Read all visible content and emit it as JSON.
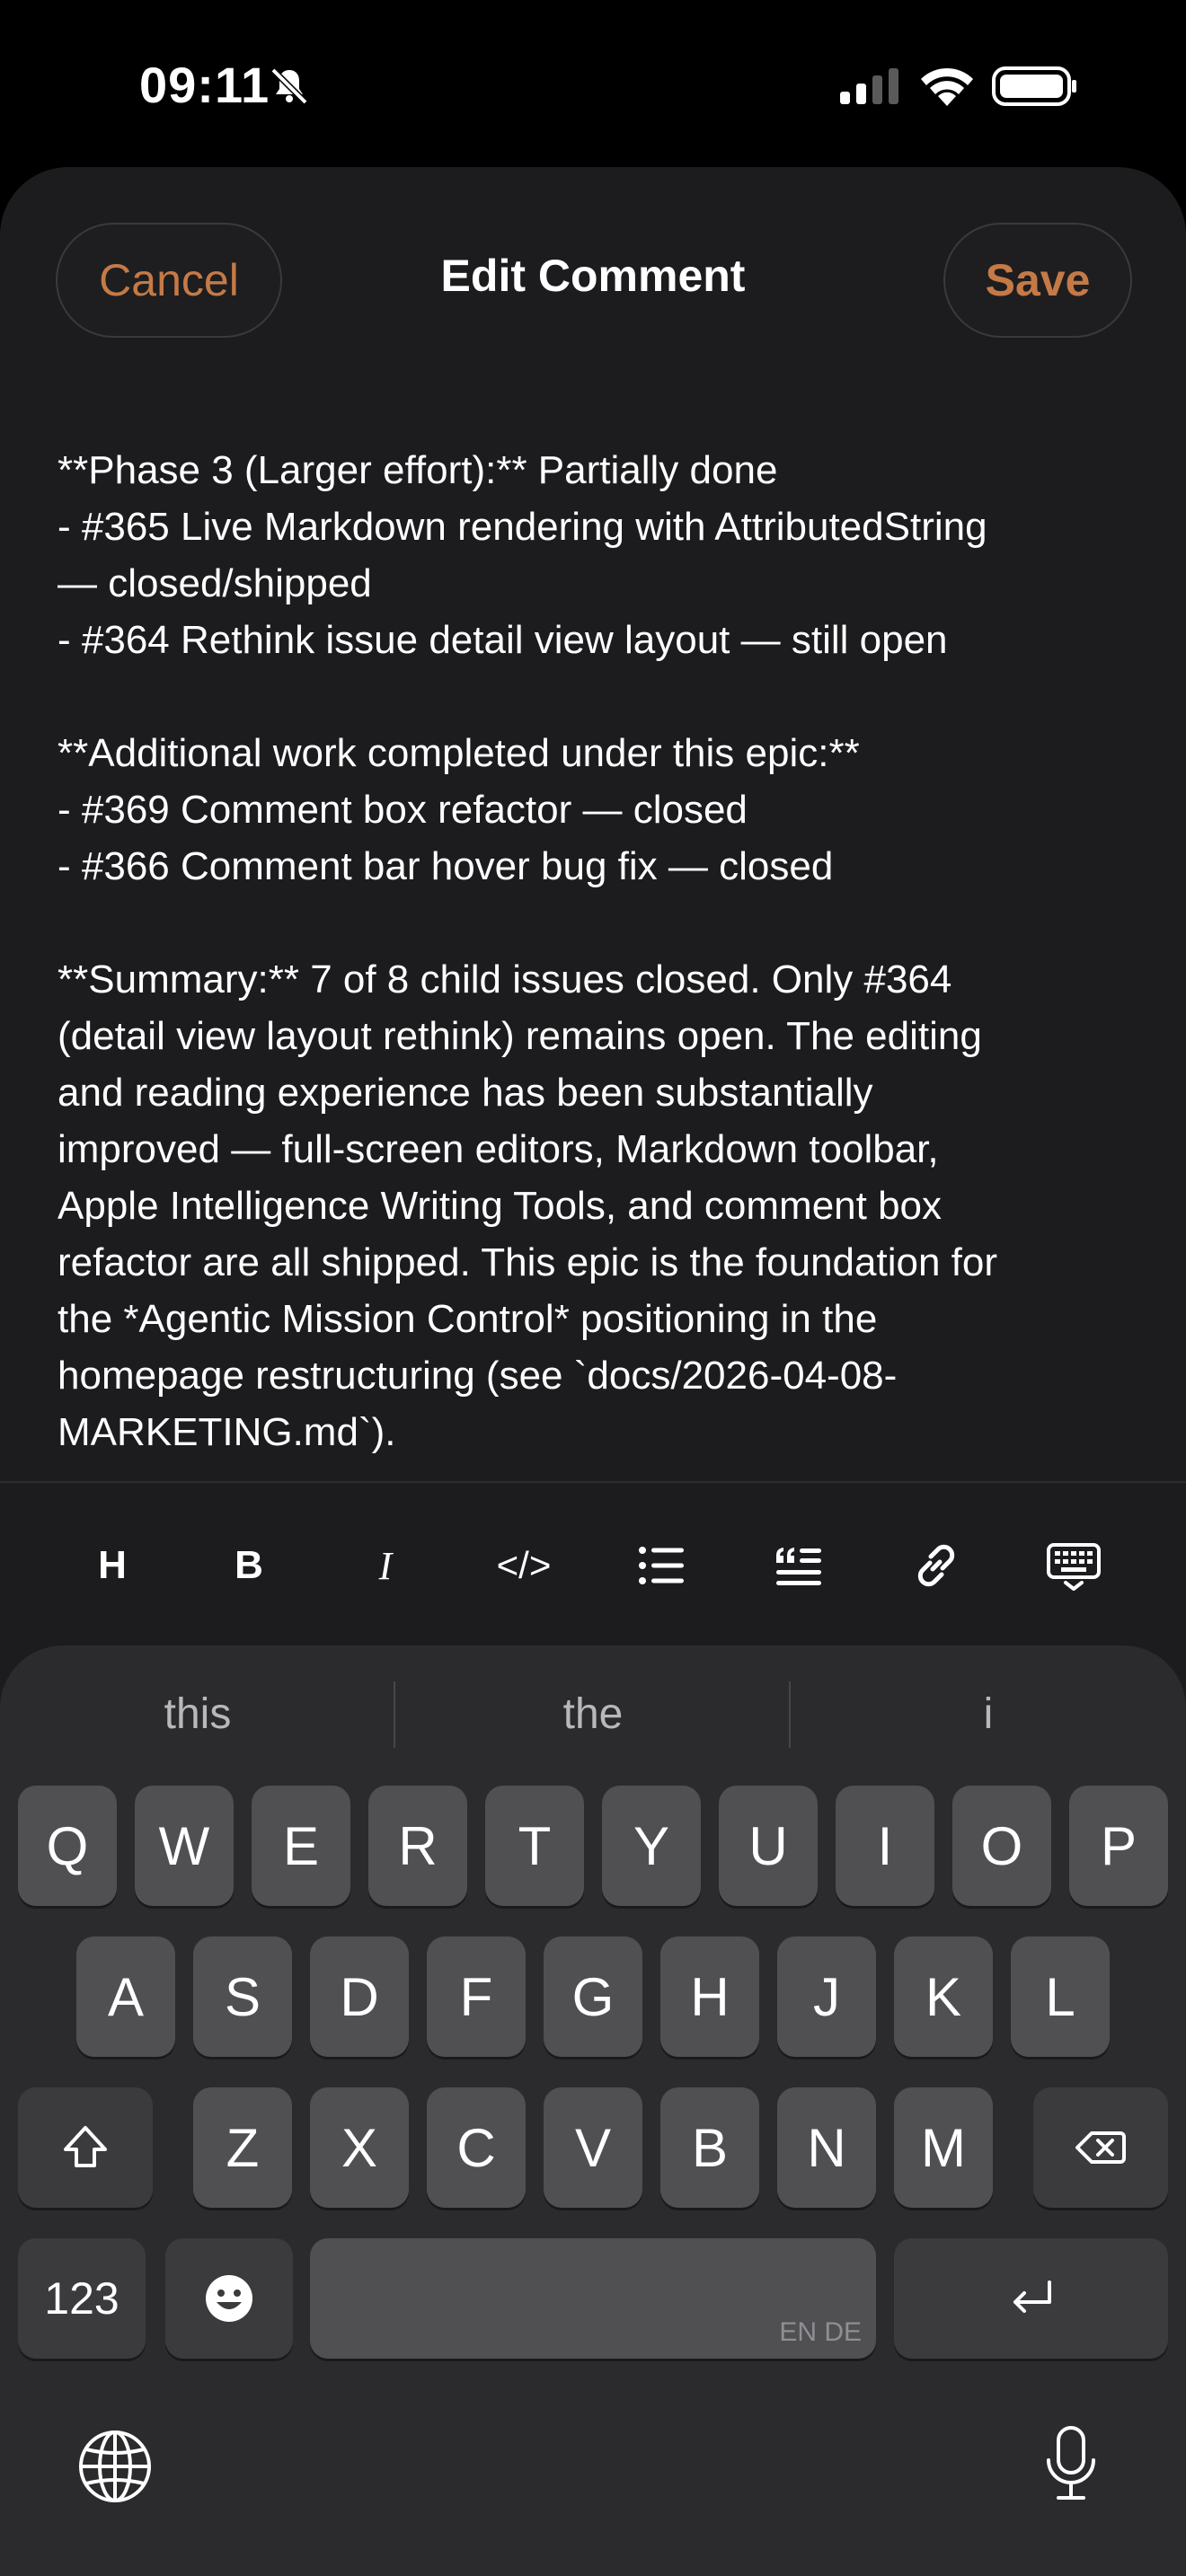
{
  "status_bar": {
    "time": "09:11"
  },
  "sheet": {
    "title": "Edit Comment",
    "cancel_label": "Cancel",
    "save_label": "Save",
    "accent_color": "#c57a46"
  },
  "editor": {
    "text": "**Phase 3 (Larger effort):** Partially done\n- #365 Live Markdown rendering with AttributedString\n— closed/shipped\n- #364 Rethink issue detail view layout — still open\n\n**Additional work completed under this epic:**\n- #369 Comment box refactor — closed\n- #366 Comment bar hover bug fix — closed\n\n**Summary:** 7 of 8 child issues closed. Only #364\n(detail view layout rethink) remains open. The editing\nand reading experience has been substantially\nimproved — full-screen editors, Markdown toolbar,\nApple Intelligence Writing Tools, and comment box\nrefactor are all shipped. This epic is the foundation for\nthe *Agentic Mission Control* positioning in the\nhomepage restructuring (see `docs/2026-04-08-\nMARKETING.md`)."
  },
  "toolbar": {
    "heading": "H",
    "bold": "B",
    "italic": "I",
    "code": "</>"
  },
  "keyboard": {
    "suggestions": [
      "this",
      "the",
      "i"
    ],
    "row1": [
      "Q",
      "W",
      "E",
      "R",
      "T",
      "Y",
      "U",
      "I",
      "O",
      "P"
    ],
    "row2": [
      "A",
      "S",
      "D",
      "F",
      "G",
      "H",
      "J",
      "K",
      "L"
    ],
    "row3": [
      "Z",
      "X",
      "C",
      "V",
      "B",
      "N",
      "M"
    ],
    "numbers_label": "123",
    "space_languages": "EN DE"
  }
}
